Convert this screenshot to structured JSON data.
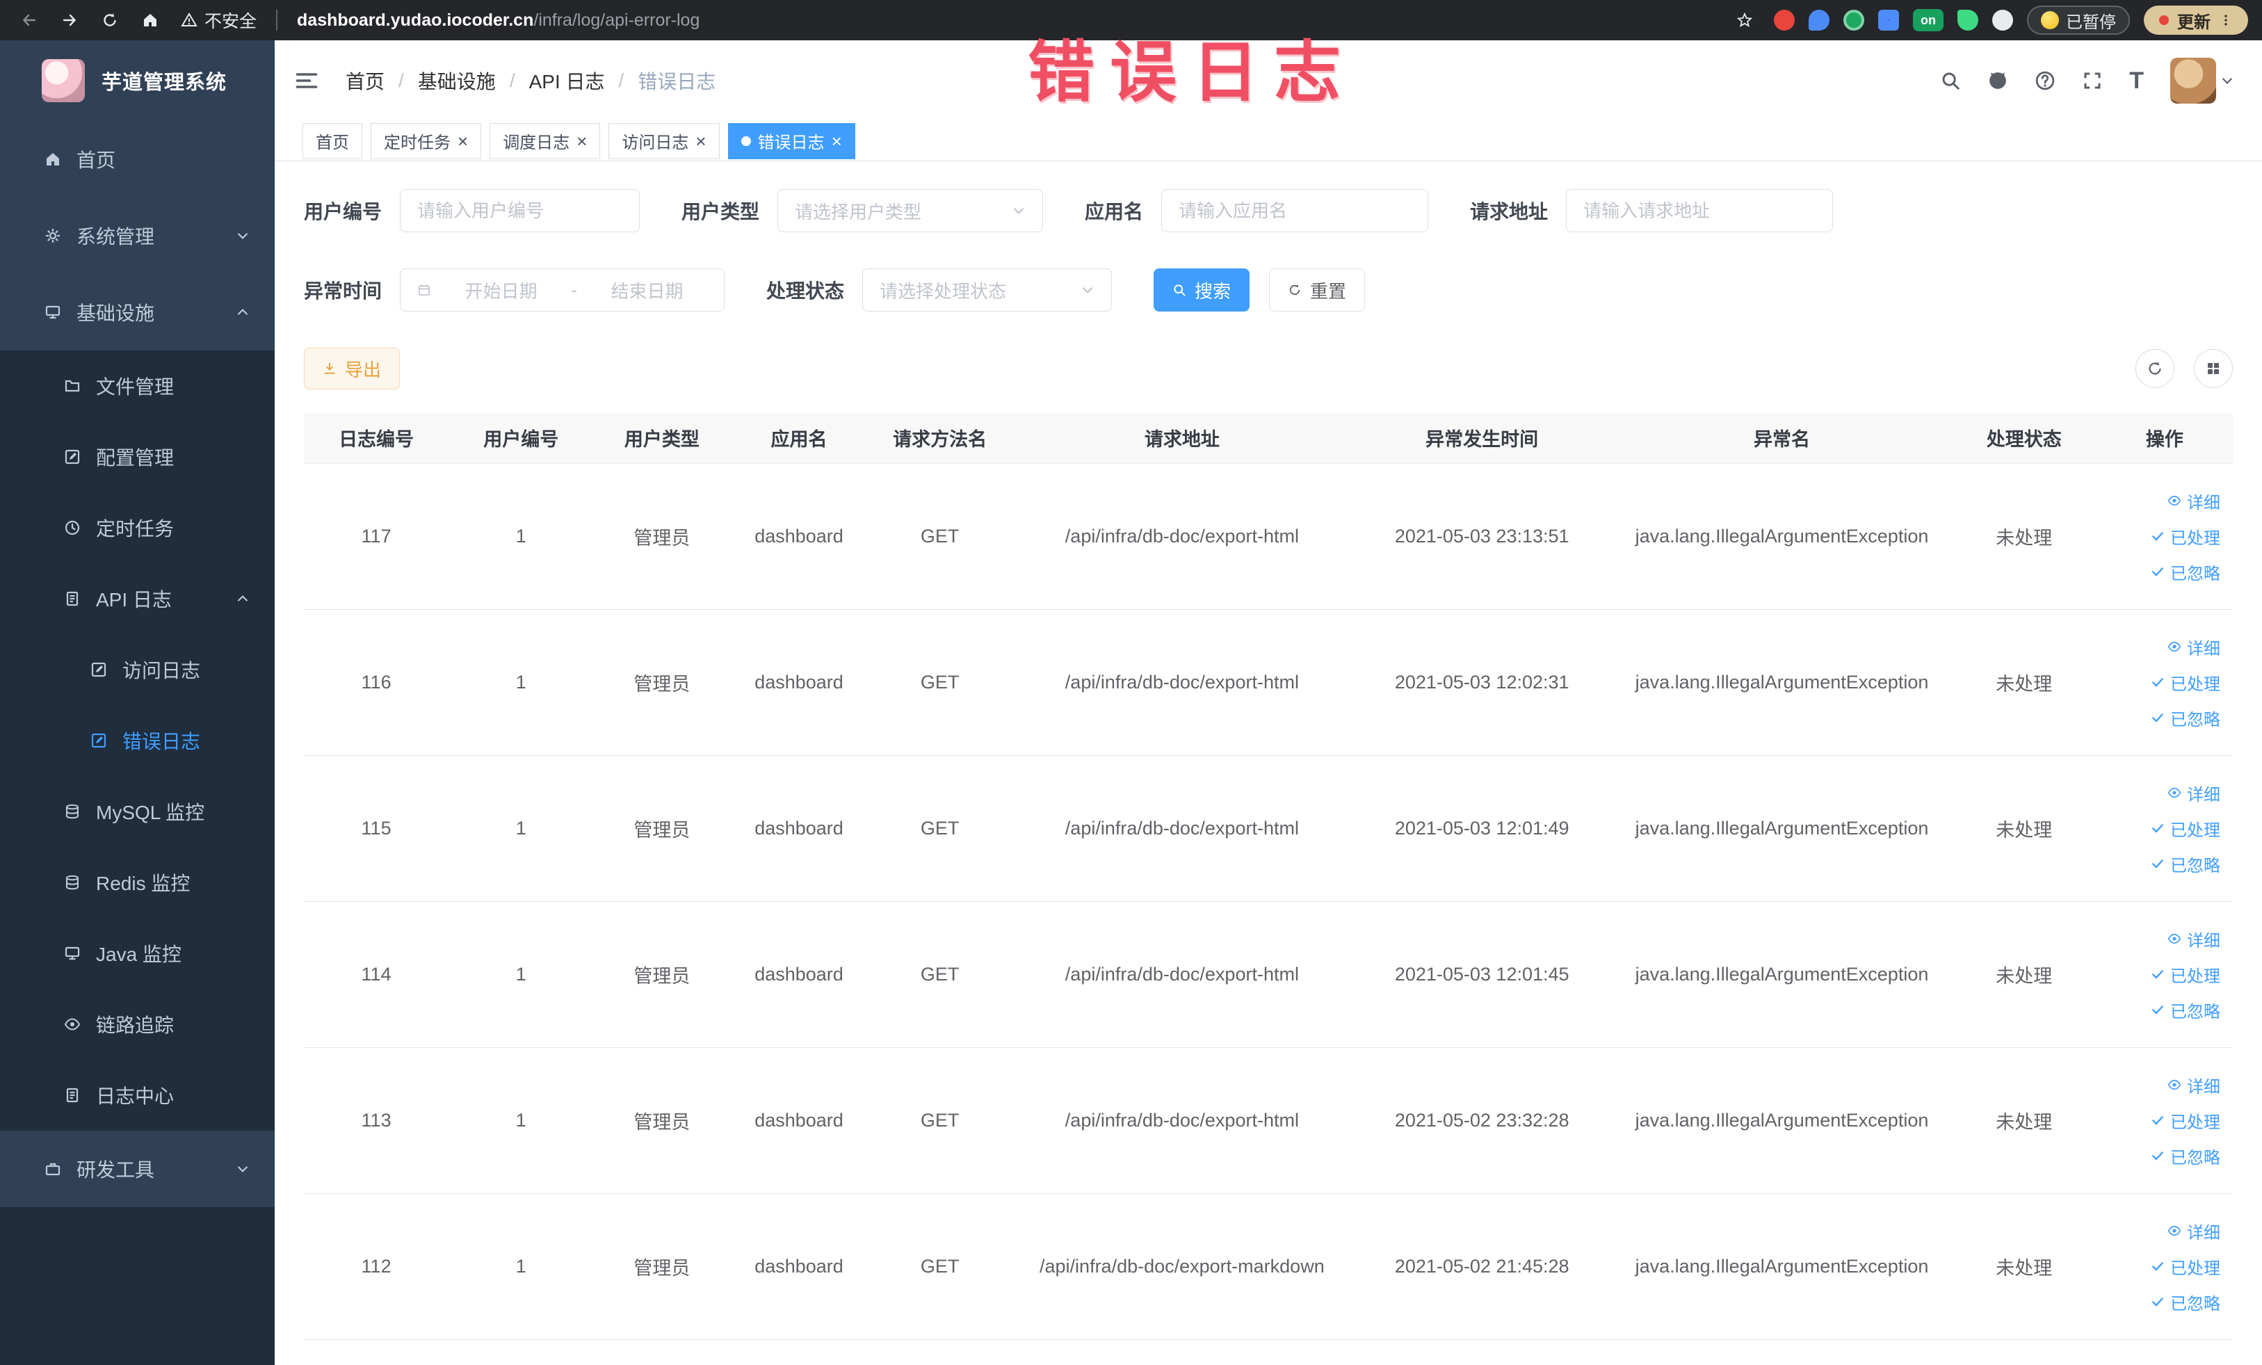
{
  "ui": {
    "close_glyph": "×"
  },
  "browser": {
    "security_label": "不安全",
    "url_host": "dashboard.yudao.iocoder.cn",
    "url_path": "/infra/log/api-error-log",
    "extension_on_label": "on",
    "paused_badge": "已暂停",
    "update_button": "更新"
  },
  "annotation": {
    "text": "错误日志"
  },
  "sidebar": {
    "logo_title": "芋道管理系统",
    "items": [
      {
        "label": "首页"
      },
      {
        "label": "系统管理"
      },
      {
        "label": "基础设施"
      },
      {
        "label": "文件管理"
      },
      {
        "label": "配置管理"
      },
      {
        "label": "定时任务"
      },
      {
        "label": "API 日志"
      },
      {
        "label": "访问日志"
      },
      {
        "label": "错误日志"
      },
      {
        "label": "MySQL 监控"
      },
      {
        "label": "Redis 监控"
      },
      {
        "label": "Java 监控"
      },
      {
        "label": "链路追踪"
      },
      {
        "label": "日志中心"
      },
      {
        "label": "研发工具"
      }
    ]
  },
  "header": {
    "breadcrumb": [
      "首页",
      "基础设施",
      "API 日志",
      "错误日志"
    ],
    "separator": "/",
    "font_size_glyph": "T"
  },
  "tabs": [
    {
      "label": "首页"
    },
    {
      "label": "定时任务"
    },
    {
      "label": "调度日志"
    },
    {
      "label": "访问日志"
    },
    {
      "label": "错误日志"
    }
  ],
  "filters": {
    "user_id": {
      "label": "用户编号",
      "placeholder": "请输入用户编号"
    },
    "user_type": {
      "label": "用户类型",
      "placeholder": "请选择用户类型"
    },
    "app_name": {
      "label": "应用名",
      "placeholder": "请输入应用名"
    },
    "request_url": {
      "label": "请求地址",
      "placeholder": "请输入请求地址"
    },
    "exception_time": {
      "label": "异常时间",
      "start_placeholder": "开始日期",
      "range_separator": "-",
      "end_placeholder": "结束日期"
    },
    "process_status": {
      "label": "处理状态",
      "placeholder": "请选择处理状态"
    },
    "search_button": "搜索",
    "reset_button": "重置"
  },
  "toolbar": {
    "export_button": "导出"
  },
  "table": {
    "columns": [
      "日志编号",
      "用户编号",
      "用户类型",
      "应用名",
      "请求方法名",
      "请求地址",
      "异常发生时间",
      "异常名",
      "处理状态",
      "操作"
    ],
    "row_actions": [
      "详细",
      "已处理",
      "已忽略"
    ],
    "rows": [
      {
        "id": "117",
        "user_id": "1",
        "user_type": "管理员",
        "app": "dashboard",
        "method": "GET",
        "url": "/api/infra/db-doc/export-html",
        "time": "2021-05-03 23:13:51",
        "exception": "java.lang.IllegalArgumentException",
        "status": "未处理"
      },
      {
        "id": "116",
        "user_id": "1",
        "user_type": "管理员",
        "app": "dashboard",
        "method": "GET",
        "url": "/api/infra/db-doc/export-html",
        "time": "2021-05-03 12:02:31",
        "exception": "java.lang.IllegalArgumentException",
        "status": "未处理"
      },
      {
        "id": "115",
        "user_id": "1",
        "user_type": "管理员",
        "app": "dashboard",
        "method": "GET",
        "url": "/api/infra/db-doc/export-html",
        "time": "2021-05-03 12:01:49",
        "exception": "java.lang.IllegalArgumentException",
        "status": "未处理"
      },
      {
        "id": "114",
        "user_id": "1",
        "user_type": "管理员",
        "app": "dashboard",
        "method": "GET",
        "url": "/api/infra/db-doc/export-html",
        "time": "2021-05-03 12:01:45",
        "exception": "java.lang.IllegalArgumentException",
        "status": "未处理"
      },
      {
        "id": "113",
        "user_id": "1",
        "user_type": "管理员",
        "app": "dashboard",
        "method": "GET",
        "url": "/api/infra/db-doc/export-html",
        "time": "2021-05-02 23:32:28",
        "exception": "java.lang.IllegalArgumentException",
        "status": "未处理"
      },
      {
        "id": "112",
        "user_id": "1",
        "user_type": "管理员",
        "app": "dashboard",
        "method": "GET",
        "url": "/api/infra/db-doc/export-markdown",
        "time": "2021-05-02 21:45:28",
        "exception": "java.lang.IllegalArgumentException",
        "status": "未处理"
      }
    ]
  },
  "colors": {
    "accent": "#409EFF",
    "warning": "#e6a23c",
    "annotation": "#f04f63",
    "sidebar_bg": "#304156",
    "submenu_bg": "#1f2d3d"
  }
}
